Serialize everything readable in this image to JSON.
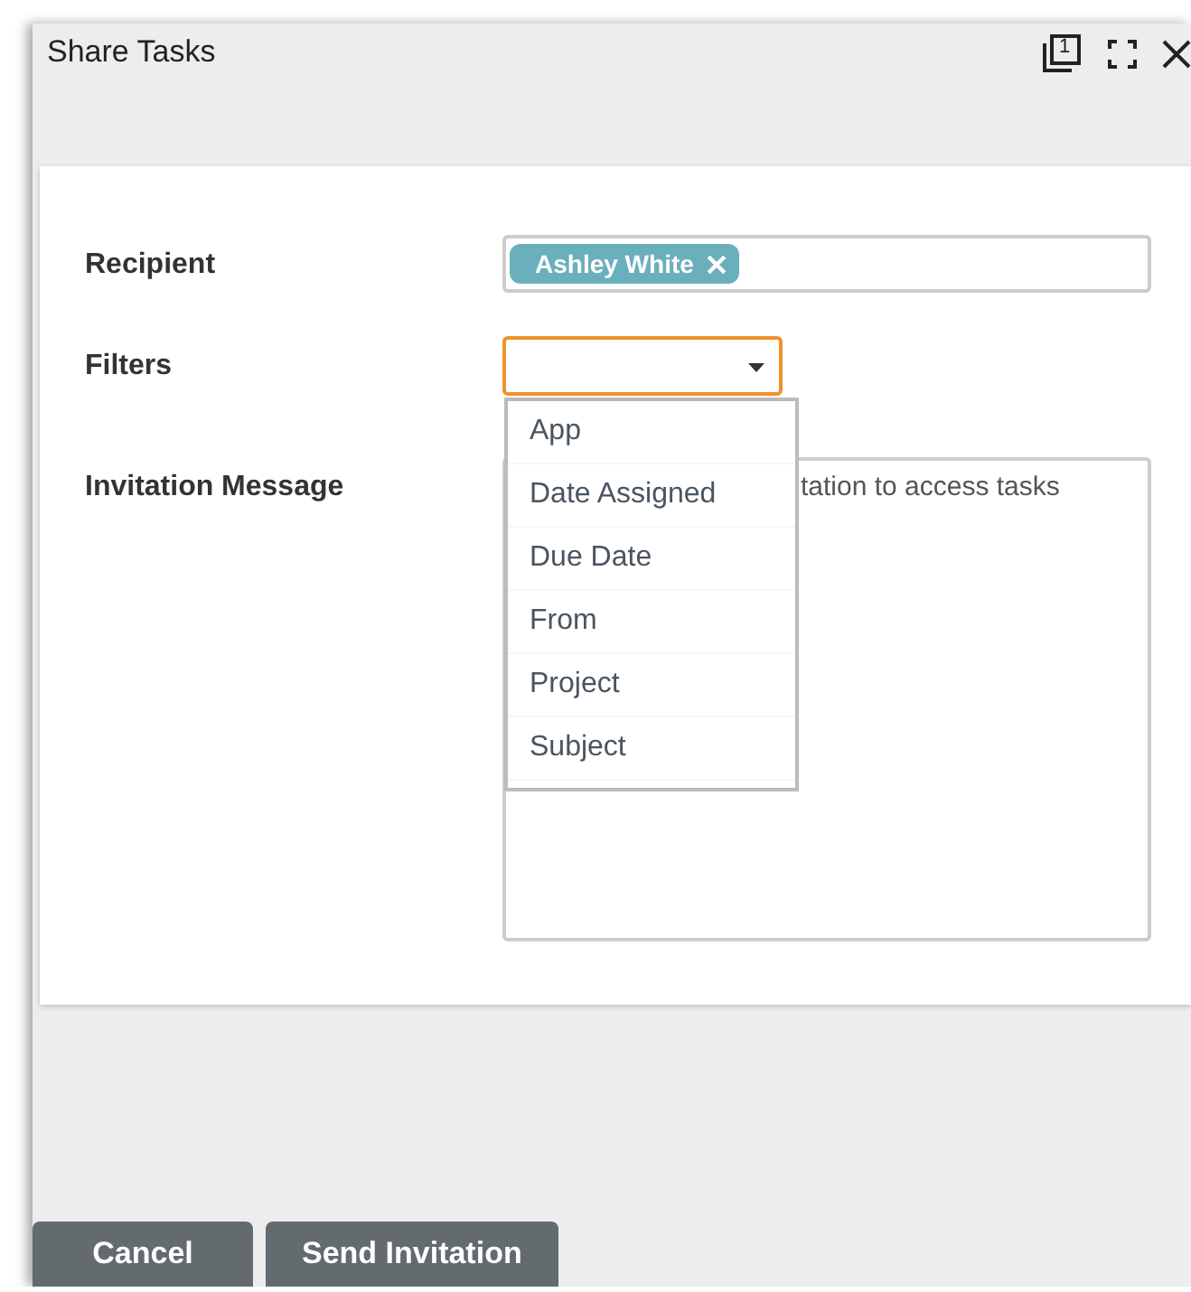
{
  "window": {
    "title": "Share Tasks",
    "window_count": "1"
  },
  "fields": [
    {
      "kind": "tags",
      "label": "Recipient",
      "tags": [
        "Ashley White"
      ]
    },
    {
      "kind": "select",
      "label": "Filters",
      "focused": true,
      "open": true,
      "options": [
        {
          "label": "App",
          "selected": false
        },
        {
          "label": "Date Assigned",
          "selected": false
        },
        {
          "label": "Due Date",
          "selected": false
        },
        {
          "label": "From",
          "selected": false
        },
        {
          "label": "Project",
          "selected": false
        },
        {
          "label": "Subject",
          "selected": false
        }
      ]
    },
    {
      "kind": "textarea",
      "label": "Invitation Message",
      "value": "tation to access tasks"
    }
  ],
  "buttons": [
    "Cancel",
    "Send Invitation"
  ]
}
